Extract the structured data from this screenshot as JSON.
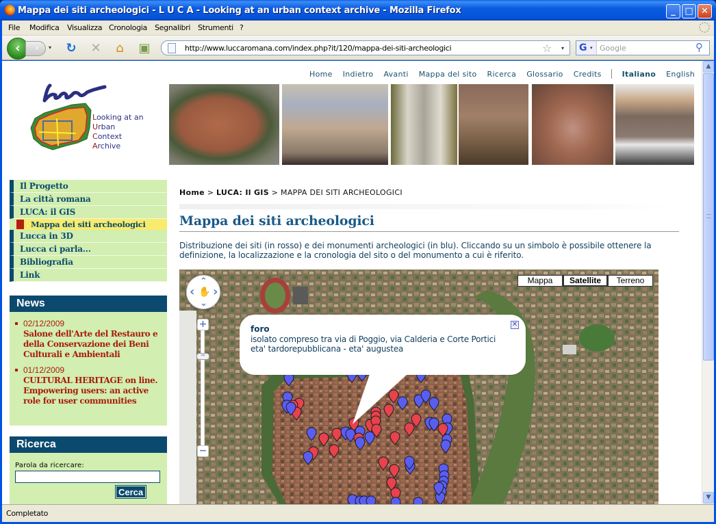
{
  "window": {
    "title": "Mappa dei siti archeologici - L U C A - Looking at an urban context archive - Mozilla Firefox",
    "min_label": "_",
    "max_label": "□",
    "close_label": "✕"
  },
  "menubar": [
    "File",
    "Modifica",
    "Visualizza",
    "Cronologia",
    "Segnalibri",
    "Strumenti",
    "?"
  ],
  "toolbar": {
    "back_icon": "‹",
    "forward_icon": "›",
    "dropdown_icon": "▾",
    "reload_icon": "↻",
    "stop_icon": "✕",
    "home_icon": "⌂",
    "bookmark_add_icon": "▣",
    "url": "http://www.luccaromana.com/index.php?it/120/mappa-dei-siti-archeologici",
    "star_icon": "☆",
    "search_engine": "G",
    "search_placeholder": "Google",
    "search_icon": "⚲"
  },
  "status": "Completato",
  "site": {
    "topnav": [
      {
        "label": "Home",
        "active": false
      },
      {
        "label": "Indietro",
        "active": false
      },
      {
        "label": "Avanti",
        "active": false
      },
      {
        "label": "Mappa del sito",
        "active": false
      },
      {
        "label": "Ricerca",
        "active": false
      },
      {
        "label": "Glossario",
        "active": false
      },
      {
        "label": "Credits",
        "active": false
      }
    ],
    "languages": [
      {
        "label": "Italiano",
        "active": true
      },
      {
        "label": "English",
        "active": false
      }
    ],
    "logo": {
      "script": "luca",
      "lines": [
        {
          "initial": "L",
          "rest": "ooking at an"
        },
        {
          "initial": "U",
          "rest": "rban"
        },
        {
          "initial": "C",
          "rest": "ontext"
        },
        {
          "initial": "A",
          "rest": "rchive"
        }
      ]
    },
    "banner_photos": [
      "aerial-city-walls",
      "frescoed-cloister",
      "roman-column-capital",
      "brick-church-arches",
      "aerial-amphitheatre",
      "medieval-house-facade"
    ]
  },
  "sidebar": {
    "menu": [
      {
        "label": "Il Progetto"
      },
      {
        "label": "La città romana"
      },
      {
        "label": "LUCA: il GIS"
      },
      {
        "label": "Mappa dei siti archeologici",
        "sub": true,
        "active": true
      },
      {
        "label": "Lucca in 3D"
      },
      {
        "label": "Lucca ci parla..."
      },
      {
        "label": "Bibliografia"
      },
      {
        "label": "Link"
      }
    ],
    "news": {
      "title": "News",
      "items": [
        {
          "date": "02/12/2009",
          "headline": "Salone dell'Arte del Restauro e della Conservazione dei Beni Culturali e Ambientali"
        },
        {
          "date": "01/12/2009",
          "headline": "CULTURAL HERITAGE on line. Empowering users: an active role for user communities"
        }
      ]
    },
    "search": {
      "title": "Ricerca",
      "label": "Parola da ricercare:",
      "value": "",
      "button": "Cerca"
    }
  },
  "main": {
    "breadcrumb": [
      {
        "label": "Home",
        "bold": true
      },
      {
        "label": "LUCA: Il GIS",
        "bold": true
      },
      {
        "label": "MAPPA DEI SITI ARCHEOLOGICI",
        "bold": false
      }
    ],
    "breadcrumb_sep": ">",
    "title": "Mappa dei siti archeologici",
    "intro": "Distribuzione dei siti (in rosso) e dei monumenti archeologici (in blu). Cliccando su un simbolo è possibile ottenere la definizione, la localizzazione e la cronologia del sito o del monumento a cui è riferito.",
    "map": {
      "types": [
        {
          "label": "Mappa",
          "selected": false
        },
        {
          "label": "Satellite",
          "selected": true
        },
        {
          "label": "Terreno",
          "selected": false
        }
      ],
      "zoom_in": "+",
      "zoom_out": "−",
      "pan_icons": {
        "up": "⌃",
        "down": "⌄",
        "left": "‹",
        "right": "›",
        "hand": "✋"
      },
      "marker_colors": {
        "site": "#e8424a",
        "monument": "#5a5ef0"
      },
      "info_window": {
        "name": "foro",
        "location": "isolato compreso tra via di Poggio, via Calderia e Corte Portici",
        "period": "eta' tardorepubblicana - eta' augustea",
        "close_icon": "✕"
      }
    }
  }
}
